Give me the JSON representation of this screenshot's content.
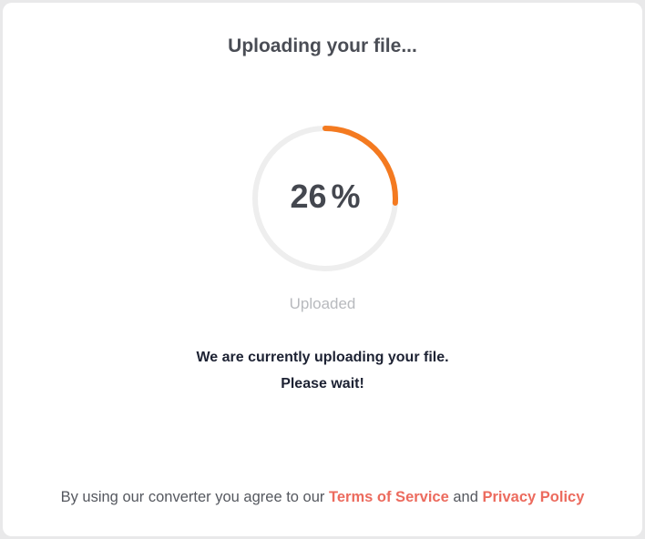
{
  "upload": {
    "title": "Uploading your file...",
    "progress": {
      "value": "26",
      "unit": "%",
      "fraction": 0.26,
      "track_color": "#eeeeee",
      "fill_color": "#f47a20"
    },
    "status_label": "Uploaded",
    "message_line1": "We are currently uploading your file.",
    "message_line2": "Please wait!"
  },
  "footer": {
    "prefix": "By using our converter you agree to our",
    "terms_link": "Terms of Service",
    "conjunction": "and",
    "privacy_link": "Privacy Policy",
    "link_color": "#ec6b5e"
  }
}
